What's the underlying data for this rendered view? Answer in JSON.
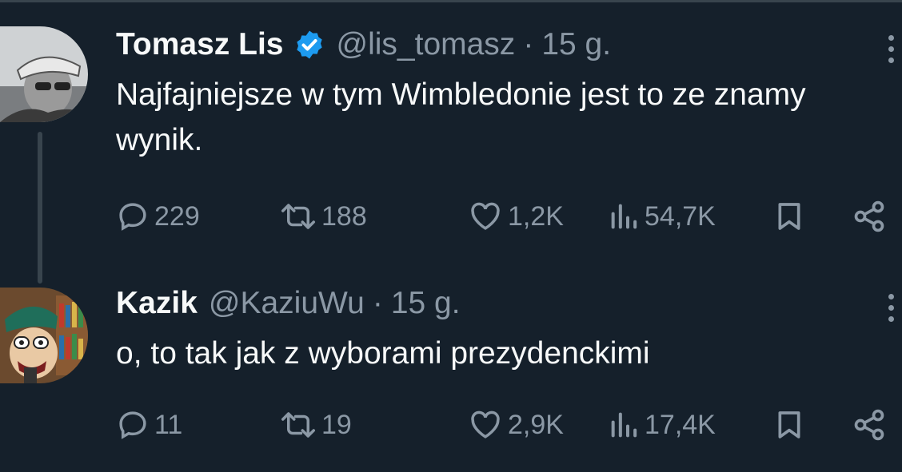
{
  "tweets": [
    {
      "name": "Tomasz Lis",
      "handle": "@lis_tomasz",
      "separator": "·",
      "time": "15 g.",
      "verified": true,
      "text": "Najfajniejsze w tym Wimbledonie jest to ze znamy wynik.",
      "stats": {
        "replies": "229",
        "retweets": "188",
        "likes": "1,2K",
        "views": "54,7K"
      }
    },
    {
      "name": "Kazik",
      "handle": "@KaziuWu",
      "separator": "·",
      "time": "15 g.",
      "verified": false,
      "text": "o, to tak jak z wyborami prezydenckimi",
      "stats": {
        "replies": "11",
        "retweets": "19",
        "likes": "2,9K",
        "views": "17,4K"
      }
    }
  ],
  "icons": [
    "reply-icon",
    "retweet-icon",
    "like-icon",
    "views-icon",
    "bookmark-icon",
    "share-icon",
    "more-icon",
    "verified-badge-icon"
  ],
  "colors": {
    "background": "#15202b",
    "secondary_text": "#8b98a5",
    "verified": "#1d9bf0"
  }
}
